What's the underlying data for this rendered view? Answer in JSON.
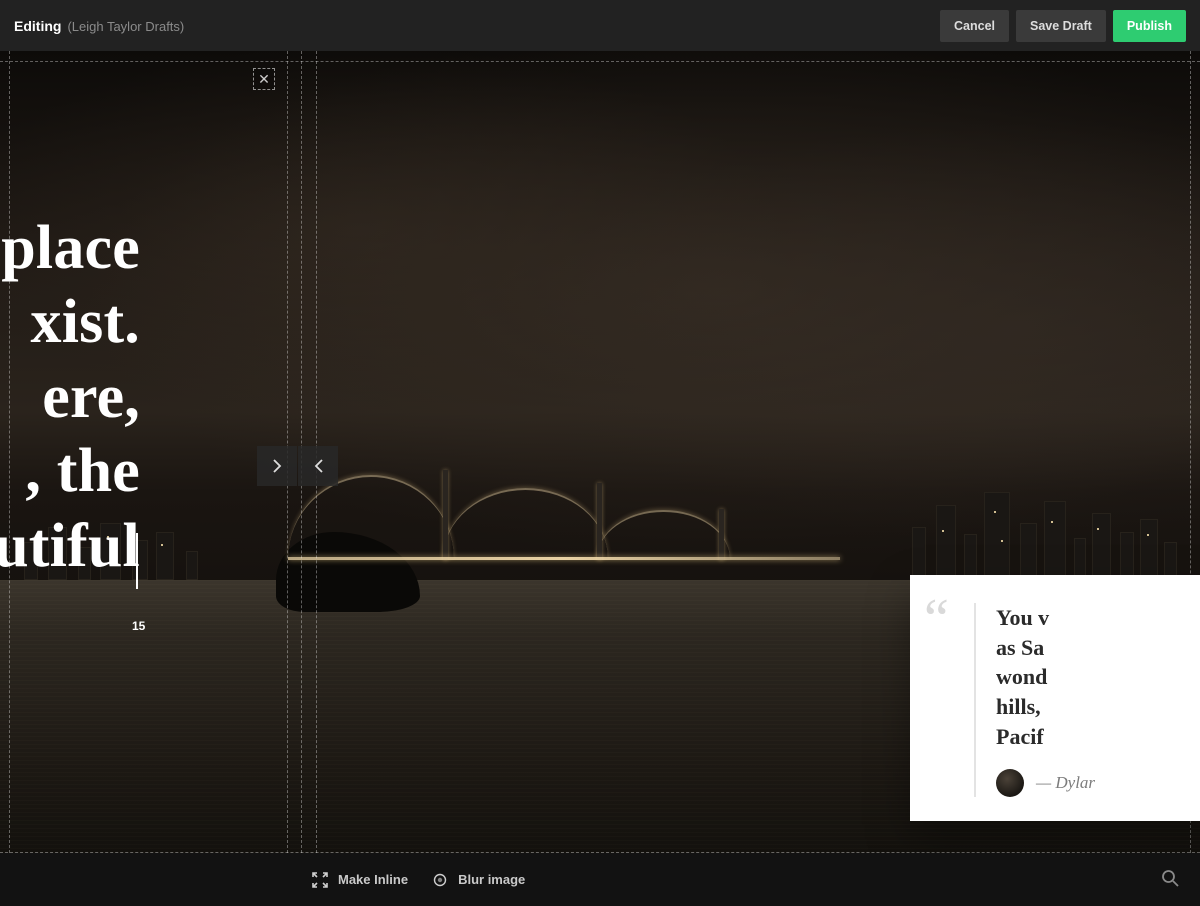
{
  "header": {
    "mode_label": "Editing",
    "context_label": "(Leigh Taylor Drafts)",
    "buttons": {
      "cancel": "Cancel",
      "save_draft": "Save Draft",
      "publish": "Publish"
    }
  },
  "colors": {
    "publish": "#2ecc71",
    "toolbar_bg": "#222222"
  },
  "hero": {
    "lines": [
      "place",
      "xist.",
      "ere,",
      ", the",
      "utiful"
    ],
    "slide_index": "15"
  },
  "quote": {
    "lines": [
      "You v",
      "as Sa",
      "wond",
      "hills,",
      "Pacif"
    ],
    "citation_prefix": "— ",
    "author_partial": "Dylar"
  },
  "toolbar": {
    "make_inline": "Make Inline",
    "blur_image": "Blur image"
  }
}
